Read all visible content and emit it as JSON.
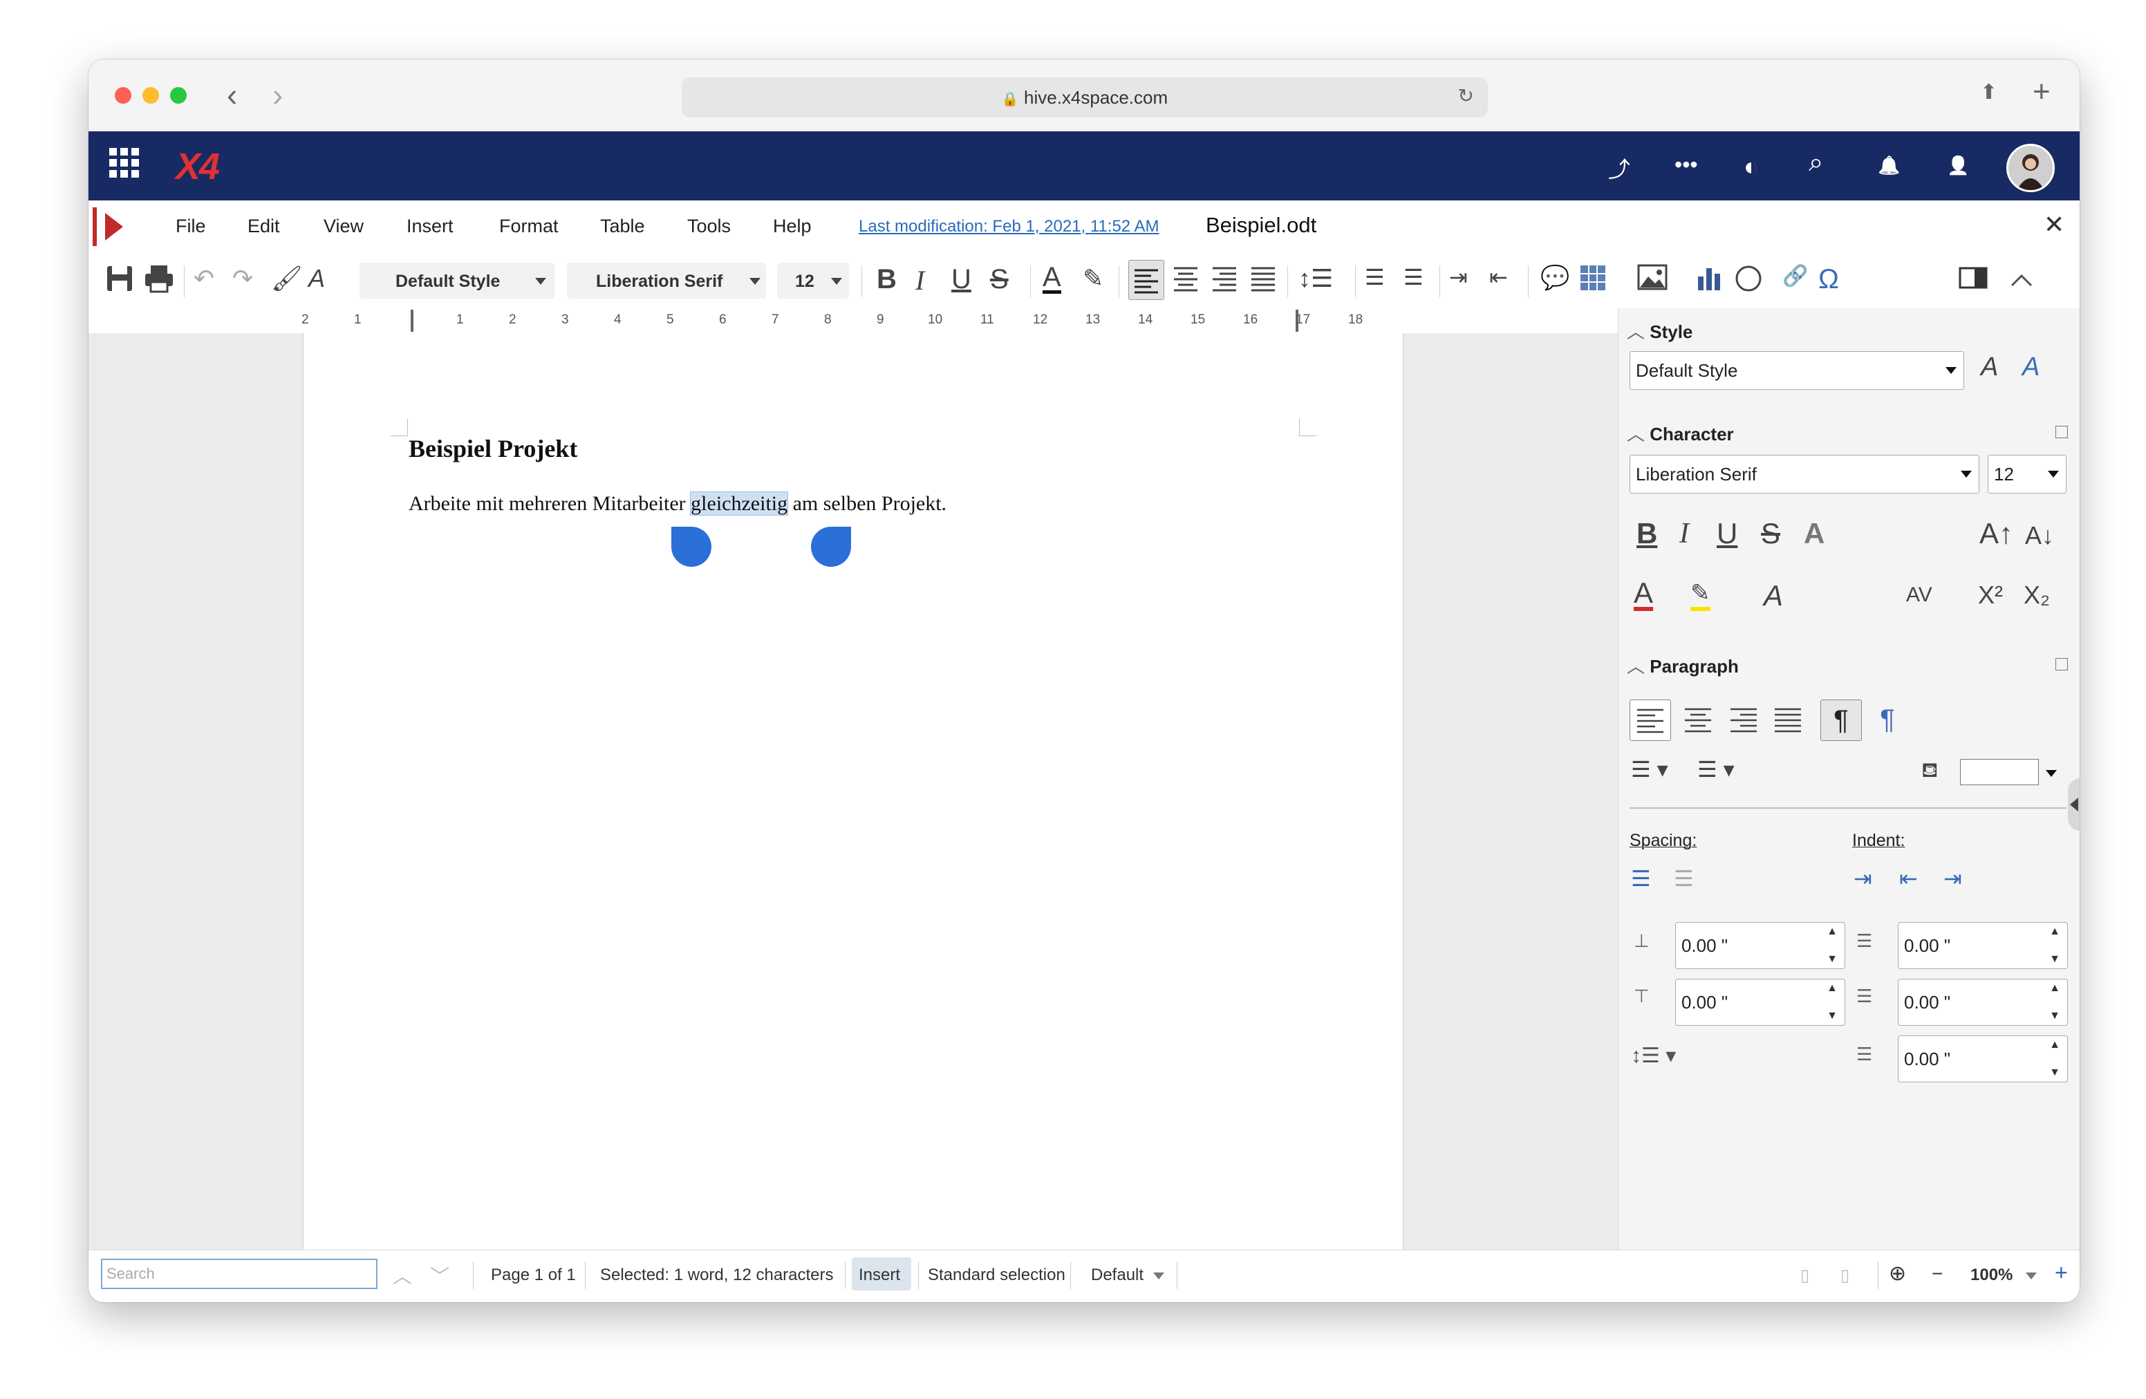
{
  "browser": {
    "url": "hive.x4space.com",
    "lock_icon": "🔒",
    "back": "‹",
    "forward": "›",
    "reload": "↻",
    "share": "⬆",
    "newtab": "+"
  },
  "app": {
    "logo": "X4",
    "grid_icon": "⋮⋮⋮",
    "header_icons": {
      "share": "⤴",
      "more": "•••",
      "palette": "◐",
      "search": "⌕",
      "bell": "🔔",
      "user": "👤"
    }
  },
  "menu": {
    "items": [
      "File",
      "Edit",
      "View",
      "Insert",
      "Format",
      "Table",
      "Tools",
      "Help"
    ],
    "last_modification": "Last modification:  Feb 1, 2021, 11:52 AM",
    "doc_name": "Beispiel.odt",
    "close": "✕"
  },
  "toolbar": {
    "style": "Default Style",
    "font": "Liberation Serif",
    "size": "12",
    "bold": "B",
    "italic": "I",
    "underline": "U",
    "strike": "S",
    "font_color": "A",
    "omega": "Ω"
  },
  "ruler": [
    "2",
    "1",
    "1",
    "2",
    "3",
    "4",
    "5",
    "6",
    "7",
    "8",
    "9",
    "10",
    "11",
    "12",
    "13",
    "14",
    "15",
    "16",
    "17",
    "18"
  ],
  "document": {
    "title": "Beispiel Projekt",
    "text_before": "Arbeite mit mehreren Mitarbeiter ",
    "text_selected": "gleichzeitig",
    "text_after": " am selben Projekt."
  },
  "sidebar": {
    "style_header": "Style",
    "style_value": "Default Style",
    "character_header": "Character",
    "font_value": "Liberation Serif",
    "size_value": "12",
    "paragraph_header": "Paragraph",
    "spacing_label": "Spacing:",
    "indent_label": "Indent:",
    "spacing_above": "0.00 \"",
    "spacing_below": "0.00 \"",
    "indent_before": "0.00 \"",
    "indent_after": "0.00 \"",
    "indent_first": "0.00 \"",
    "char_icons": {
      "bold": "B",
      "italic": "I",
      "underline": "U",
      "strike": "S",
      "shadow": "A",
      "grow": "A↑",
      "shrink": "A↓",
      "font_color": "A",
      "spacing": "AV",
      "super": "X²",
      "sub": "X₂"
    }
  },
  "status": {
    "search_placeholder": "Search",
    "page": "Page 1 of 1",
    "selected": "Selected: 1 word, 12 characters",
    "insert": "Insert",
    "selection_mode": "Standard selection",
    "language": "Default",
    "zoom": "100%",
    "minus": "−",
    "plus": "+"
  },
  "colors": {
    "header": "#172a64",
    "logo": "#e03131",
    "accent": "#2b6fd8",
    "selection": "#cfe0f3"
  }
}
